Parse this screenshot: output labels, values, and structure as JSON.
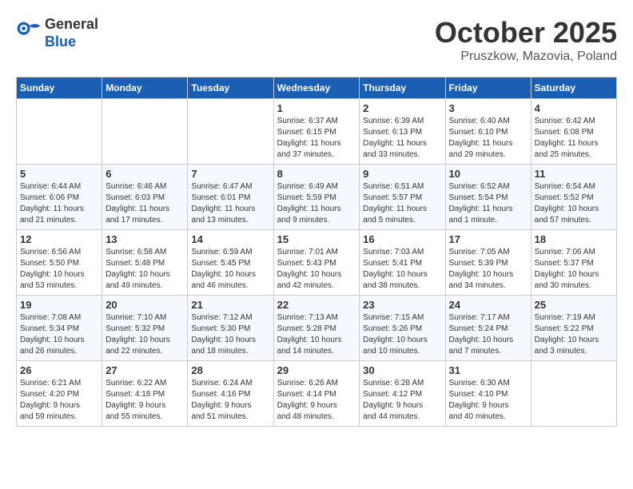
{
  "header": {
    "logo_line1": "General",
    "logo_line2": "Blue",
    "month_title": "October 2025",
    "location": "Pruszkow, Mazovia, Poland"
  },
  "days_of_week": [
    "Sunday",
    "Monday",
    "Tuesday",
    "Wednesday",
    "Thursday",
    "Friday",
    "Saturday"
  ],
  "weeks": [
    [
      {
        "day": "",
        "info": ""
      },
      {
        "day": "",
        "info": ""
      },
      {
        "day": "",
        "info": ""
      },
      {
        "day": "1",
        "info": "Sunrise: 6:37 AM\nSunset: 6:15 PM\nDaylight: 11 hours\nand 37 minutes."
      },
      {
        "day": "2",
        "info": "Sunrise: 6:39 AM\nSunset: 6:13 PM\nDaylight: 11 hours\nand 33 minutes."
      },
      {
        "day": "3",
        "info": "Sunrise: 6:40 AM\nSunset: 6:10 PM\nDaylight: 11 hours\nand 29 minutes."
      },
      {
        "day": "4",
        "info": "Sunrise: 6:42 AM\nSunset: 6:08 PM\nDaylight: 11 hours\nand 25 minutes."
      }
    ],
    [
      {
        "day": "5",
        "info": "Sunrise: 6:44 AM\nSunset: 6:06 PM\nDaylight: 11 hours\nand 21 minutes."
      },
      {
        "day": "6",
        "info": "Sunrise: 6:46 AM\nSunset: 6:03 PM\nDaylight: 11 hours\nand 17 minutes."
      },
      {
        "day": "7",
        "info": "Sunrise: 6:47 AM\nSunset: 6:01 PM\nDaylight: 11 hours\nand 13 minutes."
      },
      {
        "day": "8",
        "info": "Sunrise: 6:49 AM\nSunset: 5:59 PM\nDaylight: 11 hours\nand 9 minutes."
      },
      {
        "day": "9",
        "info": "Sunrise: 6:51 AM\nSunset: 5:57 PM\nDaylight: 11 hours\nand 5 minutes."
      },
      {
        "day": "10",
        "info": "Sunrise: 6:52 AM\nSunset: 5:54 PM\nDaylight: 11 hours\nand 1 minute."
      },
      {
        "day": "11",
        "info": "Sunrise: 6:54 AM\nSunset: 5:52 PM\nDaylight: 10 hours\nand 57 minutes."
      }
    ],
    [
      {
        "day": "12",
        "info": "Sunrise: 6:56 AM\nSunset: 5:50 PM\nDaylight: 10 hours\nand 53 minutes."
      },
      {
        "day": "13",
        "info": "Sunrise: 6:58 AM\nSunset: 5:48 PM\nDaylight: 10 hours\nand 49 minutes."
      },
      {
        "day": "14",
        "info": "Sunrise: 6:59 AM\nSunset: 5:45 PM\nDaylight: 10 hours\nand 46 minutes."
      },
      {
        "day": "15",
        "info": "Sunrise: 7:01 AM\nSunset: 5:43 PM\nDaylight: 10 hours\nand 42 minutes."
      },
      {
        "day": "16",
        "info": "Sunrise: 7:03 AM\nSunset: 5:41 PM\nDaylight: 10 hours\nand 38 minutes."
      },
      {
        "day": "17",
        "info": "Sunrise: 7:05 AM\nSunset: 5:39 PM\nDaylight: 10 hours\nand 34 minutes."
      },
      {
        "day": "18",
        "info": "Sunrise: 7:06 AM\nSunset: 5:37 PM\nDaylight: 10 hours\nand 30 minutes."
      }
    ],
    [
      {
        "day": "19",
        "info": "Sunrise: 7:08 AM\nSunset: 5:34 PM\nDaylight: 10 hours\nand 26 minutes."
      },
      {
        "day": "20",
        "info": "Sunrise: 7:10 AM\nSunset: 5:32 PM\nDaylight: 10 hours\nand 22 minutes."
      },
      {
        "day": "21",
        "info": "Sunrise: 7:12 AM\nSunset: 5:30 PM\nDaylight: 10 hours\nand 18 minutes."
      },
      {
        "day": "22",
        "info": "Sunrise: 7:13 AM\nSunset: 5:28 PM\nDaylight: 10 hours\nand 14 minutes."
      },
      {
        "day": "23",
        "info": "Sunrise: 7:15 AM\nSunset: 5:26 PM\nDaylight: 10 hours\nand 10 minutes."
      },
      {
        "day": "24",
        "info": "Sunrise: 7:17 AM\nSunset: 5:24 PM\nDaylight: 10 hours\nand 7 minutes."
      },
      {
        "day": "25",
        "info": "Sunrise: 7:19 AM\nSunset: 5:22 PM\nDaylight: 10 hours\nand 3 minutes."
      }
    ],
    [
      {
        "day": "26",
        "info": "Sunrise: 6:21 AM\nSunset: 4:20 PM\nDaylight: 9 hours\nand 59 minutes."
      },
      {
        "day": "27",
        "info": "Sunrise: 6:22 AM\nSunset: 4:18 PM\nDaylight: 9 hours\nand 55 minutes."
      },
      {
        "day": "28",
        "info": "Sunrise: 6:24 AM\nSunset: 4:16 PM\nDaylight: 9 hours\nand 51 minutes."
      },
      {
        "day": "29",
        "info": "Sunrise: 6:26 AM\nSunset: 4:14 PM\nDaylight: 9 hours\nand 48 minutes."
      },
      {
        "day": "30",
        "info": "Sunrise: 6:28 AM\nSunset: 4:12 PM\nDaylight: 9 hours\nand 44 minutes."
      },
      {
        "day": "31",
        "info": "Sunrise: 6:30 AM\nSunset: 4:10 PM\nDaylight: 9 hours\nand 40 minutes."
      },
      {
        "day": "",
        "info": ""
      }
    ]
  ]
}
